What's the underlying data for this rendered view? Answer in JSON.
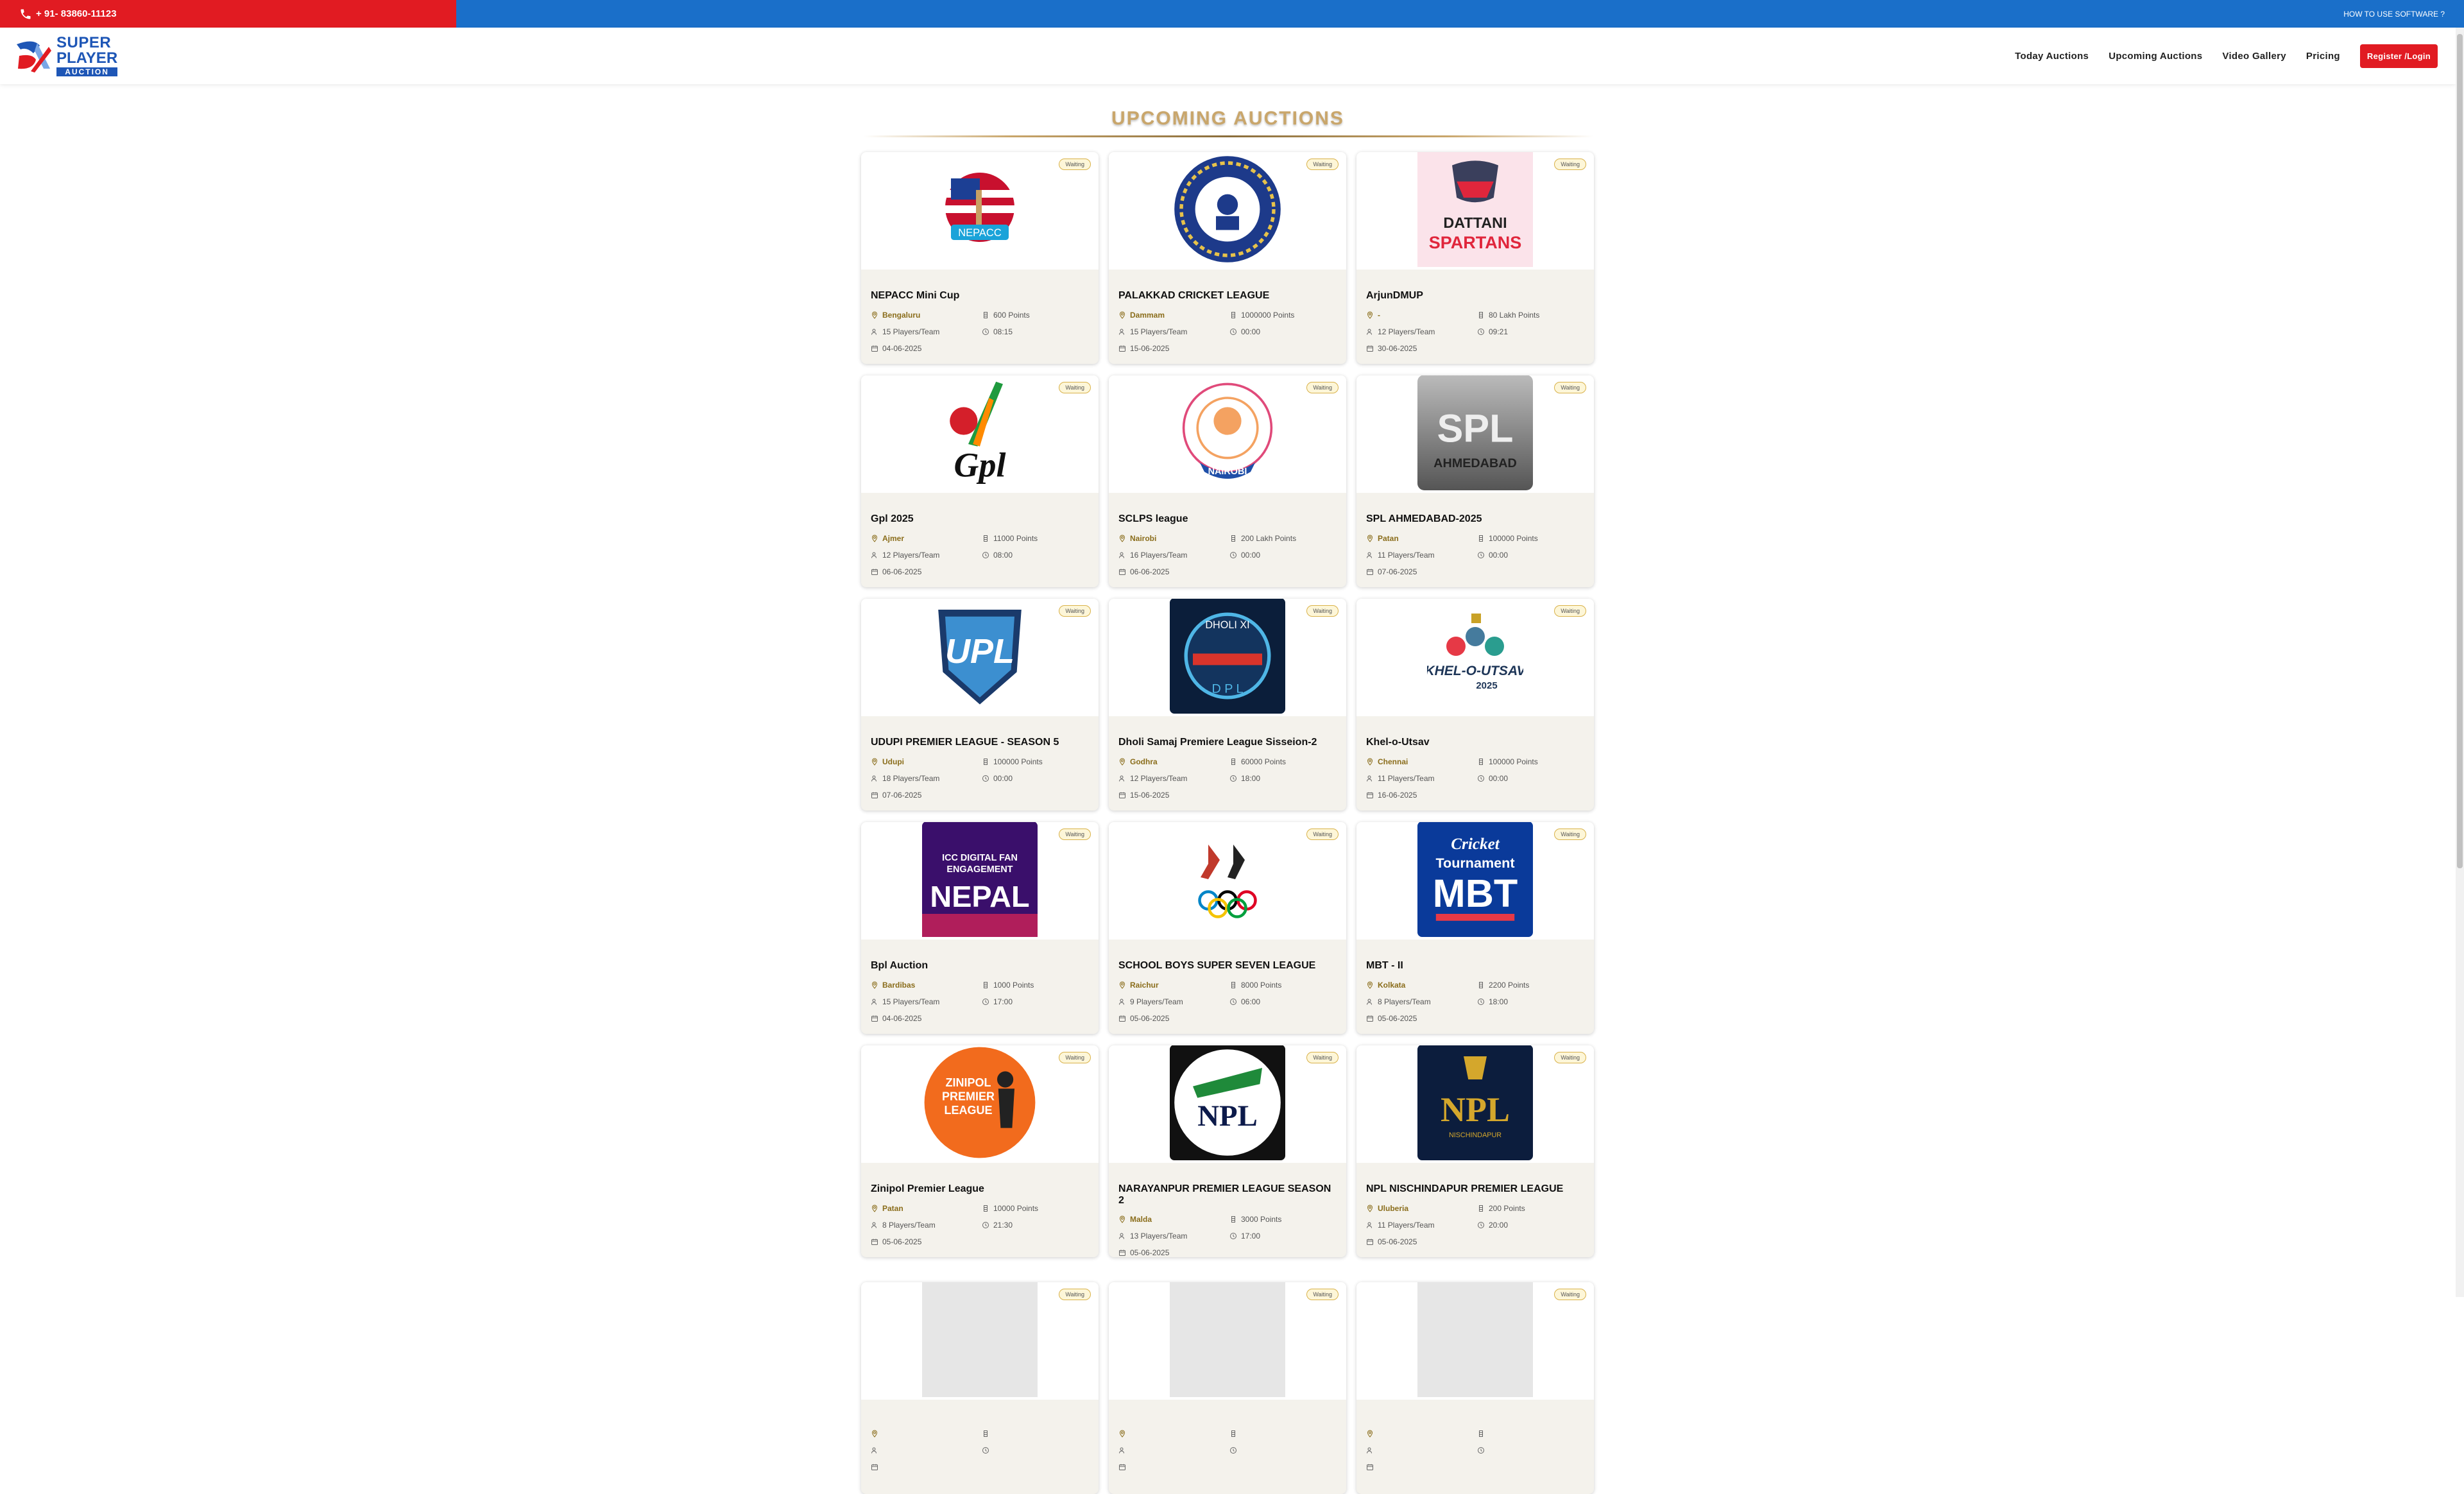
{
  "topbar": {
    "phone": "+ 91- 83860-11123",
    "help": "HOW TO USE SOFTWARE ?"
  },
  "logo": {
    "line1": "SUPER",
    "line2": "PLAYER",
    "line3": "AUCTION"
  },
  "nav": {
    "today": "Today Auctions",
    "upcoming": "Upcoming Auctions",
    "video": "Video Gallery",
    "pricing": "Pricing",
    "register": "Register /Login"
  },
  "page_title": "UPCOMING AUCTIONS",
  "colors": {
    "red": "#e11b22",
    "blue": "#1a6fc9",
    "gold": "#c9a66b"
  },
  "cards": [
    {
      "name": "NEPACC Mini Cup",
      "location": "Bengaluru",
      "points": "600 Points",
      "players": "15 Players/Team",
      "time": "08:15",
      "date": "04-06-2025",
      "status": "Waiting",
      "logo": "nepacc-logo"
    },
    {
      "name": "PALAKKAD CRICKET LEAGUE",
      "location": "Dammam",
      "points": "1000000 Points",
      "players": "15 Players/Team",
      "time": "00:00",
      "date": "15-06-2025",
      "status": "Waiting",
      "logo": "palakkad-logo"
    },
    {
      "name": "ArjunDMUP",
      "location": "-",
      "points": "80 Lakh Points",
      "players": "12 Players/Team",
      "time": "09:21",
      "date": "30-06-2025",
      "status": "Waiting",
      "logo": "dattani-spartans-logo"
    },
    {
      "name": "Gpl 2025",
      "location": "Ajmer",
      "points": "11000 Points",
      "players": "12 Players/Team",
      "time": "08:00",
      "date": "06-06-2025",
      "status": "Waiting",
      "logo": "gpl-logo"
    },
    {
      "name": "SCLPS league",
      "location": "Nairobi",
      "points": "200 Lakh Points",
      "players": "16 Players/Team",
      "time": "00:00",
      "date": "06-06-2025",
      "status": "Waiting",
      "logo": "nairobi-logo"
    },
    {
      "name": "SPL AHMEDABAD-2025",
      "location": "Patan",
      "points": "100000 Points",
      "players": "11 Players/Team",
      "time": "00:00",
      "date": "07-06-2025",
      "status": "Waiting",
      "logo": "spl-logo"
    },
    {
      "name": "UDUPI PREMIER LEAGUE - SEASON 5",
      "location": "Udupi",
      "points": "100000 Points",
      "players": "18 Players/Team",
      "time": "00:00",
      "date": "07-06-2025",
      "status": "Waiting",
      "logo": "upl-logo"
    },
    {
      "name": "Dholi Samaj Premiere League Sisseion-2",
      "location": "Godhra",
      "points": "60000 Points",
      "players": "12 Players/Team",
      "time": "18:00",
      "date": "15-06-2025",
      "status": "Waiting",
      "logo": "dholi-logo"
    },
    {
      "name": "Khel-o-Utsav",
      "location": "Chennai",
      "points": "100000 Points",
      "players": "11 Players/Team",
      "time": "00:00",
      "date": "16-06-2025",
      "status": "Waiting",
      "logo": "khel-logo"
    },
    {
      "name": "Bpl Auction",
      "location": "Bardibas",
      "points": "1000 Points",
      "players": "15 Players/Team",
      "time": "17:00",
      "date": "04-06-2025",
      "status": "Waiting",
      "logo": "nepal-logo"
    },
    {
      "name": "SCHOOL BOYS SUPER SEVEN LEAGUE",
      "location": "Raichur",
      "points": "8000 Points",
      "players": "9 Players/Team",
      "time": "06:00",
      "date": "05-06-2025",
      "status": "Waiting",
      "logo": "olympic-logo"
    },
    {
      "name": "MBT - II",
      "location": "Kolkata",
      "points": "2200 Points",
      "players": "8 Players/Team",
      "time": "18:00",
      "date": "05-06-2025",
      "status": "Waiting",
      "logo": "mbt-logo"
    },
    {
      "name": "Zinipol Premier League",
      "location": "Patan",
      "points": "10000 Points",
      "players": "8 Players/Team",
      "time": "21:30",
      "date": "05-06-2025",
      "status": "Waiting",
      "logo": "zinipol-logo"
    },
    {
      "name": "NARAYANPUR PREMIER LEAGUE SEASON 2",
      "location": "Malda",
      "points": "3000 Points",
      "players": "13 Players/Team",
      "time": "17:00",
      "date": "05-06-2025",
      "status": "Waiting",
      "logo": "npl-narayanpur-logo"
    },
    {
      "name": "NPL NISCHINDAPUR PREMIER LEAGUE",
      "location": "Uluberia",
      "points": "200 Points",
      "players": "11 Players/Team",
      "time": "20:00",
      "date": "05-06-2025",
      "status": "Waiting",
      "logo": "npl-nischindapur-logo"
    },
    {
      "name": "",
      "location": "",
      "points": "",
      "players": "",
      "time": "",
      "date": "",
      "status": "Waiting",
      "logo": "partial-logo"
    },
    {
      "name": "",
      "location": "",
      "points": "",
      "players": "",
      "time": "",
      "date": "",
      "status": "Waiting",
      "logo": "partial-logo"
    },
    {
      "name": "",
      "location": "",
      "points": "",
      "players": "",
      "time": "",
      "date": "",
      "status": "Waiting",
      "logo": "partial-logo"
    }
  ]
}
